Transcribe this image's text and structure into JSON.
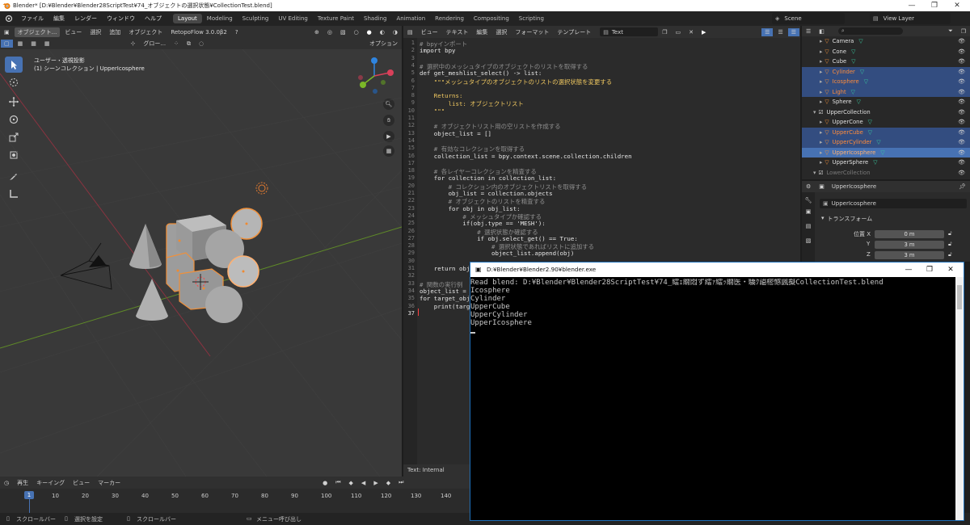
{
  "window": {
    "title": "Blender* [D:¥Blender¥Blender28ScriptTest¥74_オブジェクトの選択状態¥CollectionTest.blend]",
    "controls": [
      "—",
      "❐",
      "✕"
    ]
  },
  "menubar": {
    "menus": [
      "ファイル",
      "編集",
      "レンダー",
      "ウィンドウ",
      "ヘルプ"
    ],
    "workspaces": [
      "Layout",
      "Modeling",
      "Sculpting",
      "UV Editing",
      "Texture Paint",
      "Shading",
      "Animation",
      "Rendering",
      "Compositing",
      "Scripting"
    ],
    "active_workspace": "Layout",
    "scene": "Scene",
    "view_layer": "View Layer"
  },
  "viewport": {
    "mode": "オブジェクト...",
    "transform": "グロー...",
    "menus": [
      "ビュー",
      "選択",
      "追加",
      "オブジェクト"
    ],
    "addon": "RetopoFlow 3.0.0β2",
    "options": "オプション",
    "view_name": "ユーザー・透視投影",
    "collection_info": "(1) シーンコレクション | UpperIcosphere"
  },
  "editor": {
    "menus": [
      "ビュー",
      "テキスト",
      "編集",
      "選択",
      "フォーマット",
      "テンプレート"
    ],
    "text_name": "Text",
    "footer": "Text: Internal",
    "lines": [
      {
        "n": "1",
        "t": "# bpyインポート",
        "c": "comment"
      },
      {
        "n": "2",
        "t": "import bpy",
        "c": "kw"
      },
      {
        "n": "3",
        "t": "",
        "c": "plain"
      },
      {
        "n": "4",
        "t": "# 選択中のメッシュタイプのオブジェクトのリストを取得する",
        "c": "comment"
      },
      {
        "n": "5",
        "t": "def get_meshlist_select() -> list:",
        "c": "kw"
      },
      {
        "n": "6",
        "t": "    \"\"\"メッシュタイプのオブジェクトのリストの選択状態を変更する",
        "c": "str"
      },
      {
        "n": "7",
        "t": "",
        "c": "plain"
      },
      {
        "n": "8",
        "t": "    Returns:",
        "c": "str"
      },
      {
        "n": "9",
        "t": "        list: オブジェクトリスト",
        "c": "str"
      },
      {
        "n": "10",
        "t": "    \"\"\"",
        "c": "str"
      },
      {
        "n": "11",
        "t": "",
        "c": "plain"
      },
      {
        "n": "12",
        "t": "    # オブジェクトリスト用の空リストを作成する",
        "c": "comment"
      },
      {
        "n": "13",
        "t": "    object_list = []",
        "c": "plain"
      },
      {
        "n": "14",
        "t": "",
        "c": "plain"
      },
      {
        "n": "15",
        "t": "    # 有効なコレクションを取得する",
        "c": "comment"
      },
      {
        "n": "16",
        "t": "    collection_list = bpy.context.scene.collection.children",
        "c": "plain"
      },
      {
        "n": "17",
        "t": "",
        "c": "plain"
      },
      {
        "n": "18",
        "t": "    # 各レイヤーコレクションを精査する",
        "c": "comment"
      },
      {
        "n": "19",
        "t": "    for collection in collection_list:",
        "c": "kw"
      },
      {
        "n": "20",
        "t": "        # コレクション内のオブジェクトリストを取得する",
        "c": "comment"
      },
      {
        "n": "21",
        "t": "        obj_list = collection.objects",
        "c": "plain"
      },
      {
        "n": "22",
        "t": "        # オブジェクトのリストを精査する",
        "c": "comment"
      },
      {
        "n": "23",
        "t": "        for obj in obj_list:",
        "c": "kw"
      },
      {
        "n": "24",
        "t": "            # メッシュタイプか確認する",
        "c": "comment"
      },
      {
        "n": "25",
        "t": "            if(obj.type == 'MESH'):",
        "c": "kw"
      },
      {
        "n": "26",
        "t": "                # 選択状態か確認する",
        "c": "comment"
      },
      {
        "n": "27",
        "t": "                if obj.select_get() == True:",
        "c": "kw"
      },
      {
        "n": "28",
        "t": "                    # 選択状態であればリストに追加する",
        "c": "comment"
      },
      {
        "n": "29",
        "t": "                    object_list.append(obj)",
        "c": "plain"
      },
      {
        "n": "30",
        "t": "",
        "c": "plain"
      },
      {
        "n": "31",
        "t": "    return obj",
        "c": "kw"
      },
      {
        "n": "32",
        "t": "",
        "c": "plain"
      },
      {
        "n": "33",
        "t": "# 関数の実行例",
        "c": "comment"
      },
      {
        "n": "34",
        "t": "object_list =",
        "c": "plain"
      },
      {
        "n": "35",
        "t": "for target_obj",
        "c": "kw"
      },
      {
        "n": "36",
        "t": "    print(targ",
        "c": "plain"
      },
      {
        "n": "37",
        "t": "",
        "c": "plain"
      }
    ]
  },
  "outliner": {
    "rows": [
      {
        "name": "Camera",
        "state": "plain",
        "color": "#e0e0e0",
        "indent": 30
      },
      {
        "name": "Cone",
        "state": "plain",
        "color": "#e0e0e0",
        "indent": 30
      },
      {
        "name": "Cube",
        "state": "plain",
        "color": "#e0e0e0",
        "indent": 30
      },
      {
        "name": "Cylinder",
        "state": "sel",
        "color": "#ff8c3a",
        "indent": 30
      },
      {
        "name": "Icosphere",
        "state": "sel",
        "color": "#ff8c3a",
        "indent": 30
      },
      {
        "name": "Light",
        "state": "sel",
        "color": "#ff8c3a",
        "indent": 30
      },
      {
        "name": "Sphere",
        "state": "plain",
        "color": "#e0e0e0",
        "indent": 30
      },
      {
        "name": "UpperCollection",
        "state": "plain",
        "color": "#e0e0e0",
        "indent": 22
      },
      {
        "name": "UpperCone",
        "state": "plain",
        "color": "#e0e0e0",
        "indent": 30
      },
      {
        "name": "UpperCube",
        "state": "sel",
        "color": "#ff8c3a",
        "indent": 30
      },
      {
        "name": "UpperCylinder",
        "state": "sel",
        "color": "#ff8c3a",
        "indent": 30
      },
      {
        "name": "UpperIcosphere",
        "state": "active",
        "color": "#ffb070",
        "indent": 30
      },
      {
        "name": "UpperSphere",
        "state": "plain",
        "color": "#e0e0e0",
        "indent": 30
      },
      {
        "name": "LowerCollection",
        "state": "plain",
        "color": "#7a7a7a",
        "indent": 22
      }
    ]
  },
  "properties": {
    "object_name": "UpperIcosphere",
    "data_name": "UpperIcosphere",
    "section": "トランスフォーム",
    "location_label": "位置 X",
    "y_label": "Y",
    "z_label": "Z",
    "x_value": "0 m",
    "y_value": "3 m",
    "z_value": "3 m"
  },
  "console": {
    "title": "D:¥Blender¥Blender2.90¥blender.exe",
    "lines": [
      "Read blend: D:¥Blender¥Blender28ScriptTest¥74_繧ｪ繝悶ず繧ｧ繧ｯ繝医・驕ｸ謚樒憾諷擬CollectionTest.blend",
      "Icosphere",
      "Cylinder",
      "UpperCube",
      "UpperCylinder",
      "UpperIcosphere"
    ]
  },
  "timeline": {
    "menus": [
      "再生",
      "キーイング",
      "ビュー",
      "マーカー"
    ],
    "current_frame": "1",
    "ticks": [
      "10",
      "20",
      "30",
      "40",
      "50",
      "60",
      "70",
      "80",
      "90",
      "100",
      "110",
      "120",
      "130",
      "140"
    ]
  },
  "statusbar": {
    "items": [
      "スクロールバー",
      "選択を設定",
      "スクロールバー",
      "メニュー呼び出し"
    ]
  }
}
